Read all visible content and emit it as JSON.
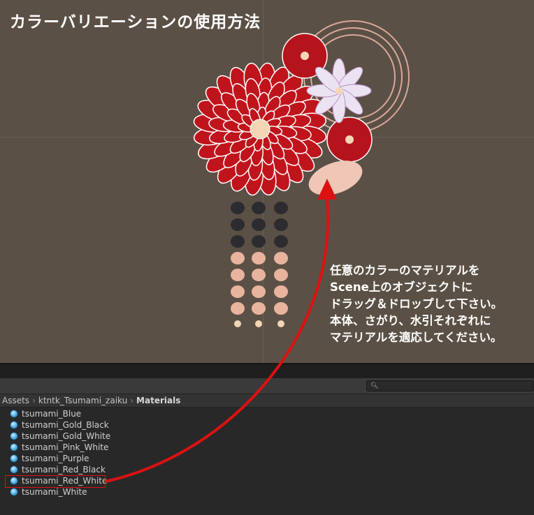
{
  "scene": {
    "title": "カラーバリエーションの使用方法",
    "instructions": "任意のカラーのマテリアルを\nScene上のオブジェクトに\nドラッグ＆ドロップして下さい。\n本体、さがり、水引それぞれに\nマテリアルを適応してください。"
  },
  "project": {
    "search_icon": "search-icon",
    "breadcrumb": [
      "Assets",
      "ktntk_Tsumami_zaiku",
      "Materials"
    ],
    "materials": [
      "tsumami_Blue",
      "tsumami_Gold_Black",
      "tsumami_Gold_White",
      "tsumami_Pink_White",
      "tsumami_Purple",
      "tsumami_Red_Black",
      "tsumami_Red_White",
      "tsumami_White"
    ],
    "selected": "tsumami_Red_White"
  },
  "colors": {
    "arrow": "#dd1111",
    "scene_bg": "#5b5045",
    "panel_bg": "#282828"
  }
}
